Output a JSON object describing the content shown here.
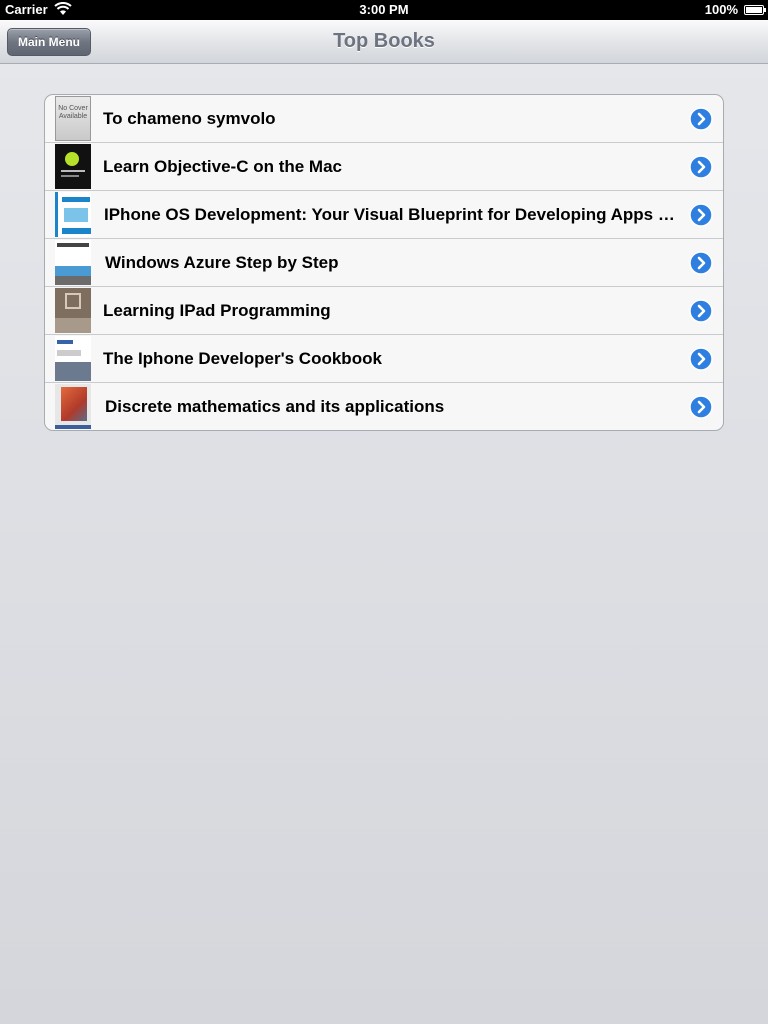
{
  "status_bar": {
    "carrier": "Carrier",
    "time": "3:00 PM",
    "battery": "100%"
  },
  "nav": {
    "title": "Top Books",
    "back_label": "Main Menu"
  },
  "books": [
    {
      "title": "To chameno symvolo",
      "cover_text": "No Cover Available"
    },
    {
      "title": "Learn Objective-C on the Mac"
    },
    {
      "title": "IPhone OS Development: Your Visual Blueprint for Developing Apps for Apple's Mobile Interface"
    },
    {
      "title": "Windows Azure Step by Step"
    },
    {
      "title": "Learning IPad Programming"
    },
    {
      "title": "The Iphone Developer's Cookbook"
    },
    {
      "title": "Discrete mathematics and its applications"
    }
  ],
  "colors": {
    "disclosure_blue": "#2f7fe0",
    "title_gray": "#6d7380"
  }
}
